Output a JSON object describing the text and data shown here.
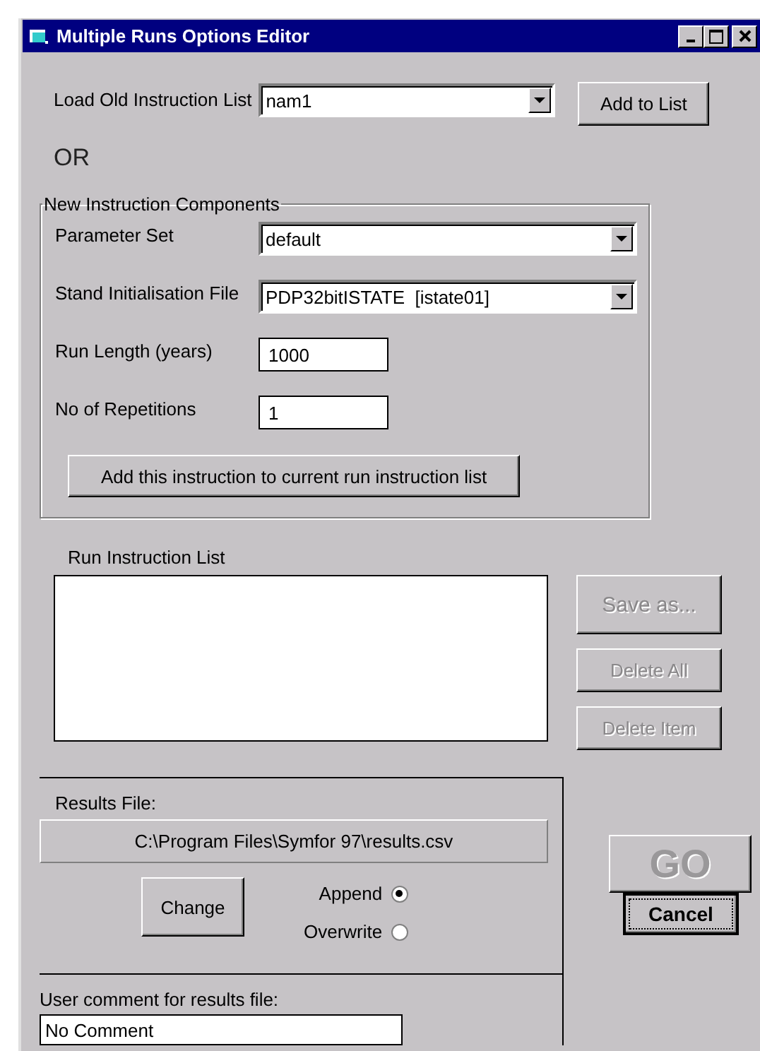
{
  "window": {
    "title": "Multiple Runs Options Editor"
  },
  "load": {
    "label": "Load Old Instruction List",
    "value": "nam1",
    "button": "Add to List"
  },
  "or_text": "OR",
  "group": {
    "title": "New Instruction Components",
    "fields": [
      {
        "kind": "combo",
        "label": "Parameter Set",
        "value": "default"
      },
      {
        "kind": "combo",
        "label": "Stand Initialisation File",
        "value": "PDP32bitISTATE  [istate01]"
      },
      {
        "kind": "input",
        "label": "Run Length (years)",
        "value": "1000"
      },
      {
        "kind": "input",
        "label": "No of Repetitions",
        "value": "1"
      }
    ],
    "button": "Add this instruction to current run instruction list"
  },
  "run_list": {
    "label": "Run Instruction List"
  },
  "side_buttons": [
    {
      "label": "Save as...",
      "disabled": true
    },
    {
      "label": "Delete All",
      "disabled": true
    },
    {
      "label": "Delete Item",
      "disabled": true
    }
  ],
  "results": {
    "label": "Results File:",
    "path": "C:\\Program Files\\Symfor 97\\results.csv",
    "change_button": "Change",
    "options": [
      {
        "label": "Append",
        "selected": true
      },
      {
        "label": "Overwrite",
        "selected": false
      }
    ]
  },
  "go_button": {
    "label": "GO",
    "disabled": true
  },
  "cancel_button": {
    "label": "Cancel"
  },
  "comment": {
    "label": "User comment for results file:",
    "value": "No Comment"
  }
}
